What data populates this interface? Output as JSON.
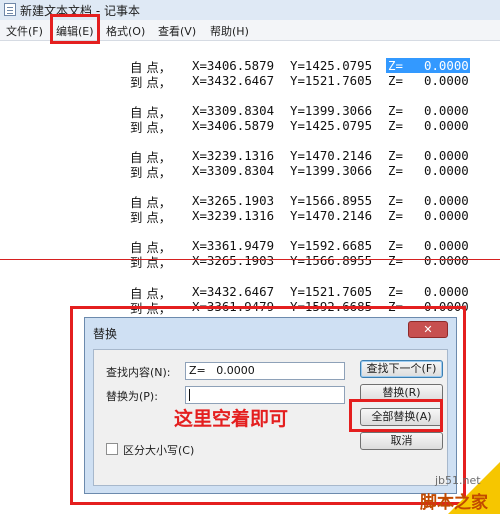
{
  "window": {
    "title": "新建文本文档 - 记事本"
  },
  "menu": [
    {
      "label": "文件(F)"
    },
    {
      "label": "编辑(E)"
    },
    {
      "label": "格式(O)"
    },
    {
      "label": "查看(V)"
    },
    {
      "label": "帮助(H)"
    }
  ],
  "editor": {
    "rows": [
      {
        "label": "自 点，",
        "x": "X=3406.5879",
        "y": "Y=1425.0795",
        "z_label": "Z=",
        "z": "0.0000"
      },
      {
        "label": "到 点，",
        "x": "X=3432.6467",
        "y": "Y=1521.7605",
        "z_label": "Z=",
        "z": "0.0000"
      },
      {
        "label": "自 点，",
        "x": "X=3309.8304",
        "y": "Y=1399.3066",
        "z_label": "Z=",
        "z": "0.0000"
      },
      {
        "label": "到 点，",
        "x": "X=3406.5879",
        "y": "Y=1425.0795",
        "z_label": "Z=",
        "z": "0.0000"
      },
      {
        "label": "自 点，",
        "x": "X=3239.1316",
        "y": "Y=1470.2146",
        "z_label": "Z=",
        "z": "0.0000"
      },
      {
        "label": "到 点，",
        "x": "X=3309.8304",
        "y": "Y=1399.3066",
        "z_label": "Z=",
        "z": "0.0000"
      },
      {
        "label": "自 点，",
        "x": "X=3265.1903",
        "y": "Y=1566.8955",
        "z_label": "Z=",
        "z": "0.0000"
      },
      {
        "label": "到 点，",
        "x": "X=3239.1316",
        "y": "Y=1470.2146",
        "z_label": "Z=",
        "z": "0.0000"
      },
      {
        "label": "自 点，",
        "x": "X=3361.9479",
        "y": "Y=1592.6685",
        "z_label": "Z=",
        "z": "0.0000"
      },
      {
        "label": "到 点，",
        "x": "X=3265.1903",
        "y": "Y=1566.8955",
        "z_label": "Z=",
        "z": "0.0000"
      },
      {
        "label": "自 点，",
        "x": "X=3432.6467",
        "y": "Y=1521.7605",
        "z_label": "Z=",
        "z": "0.0000"
      },
      {
        "label": "到 点，",
        "x": "X=3361.9479",
        "y": "Y=1592.6685",
        "z_label": "Z=",
        "z": "0.0000"
      }
    ]
  },
  "dialog": {
    "title": "替换",
    "close_glyph": "✕",
    "find_label": "查找内容(N):",
    "find_value": "Z=   0.0000",
    "replace_label": "替换为(P):",
    "replace_value": "",
    "find_next_button": "查找下一个(F)",
    "replace_button": "替换(R)",
    "replace_all_button": "全部替换(A)",
    "cancel_button": "取消",
    "match_case_label": "区分大小写(C)"
  },
  "annotation": {
    "text": "这里空着即可"
  },
  "watermark": {
    "site": "jb51.net",
    "name": "脚本之家"
  },
  "colors": {
    "highlight_box": "#e41f1f",
    "selection": "#3399ff"
  }
}
